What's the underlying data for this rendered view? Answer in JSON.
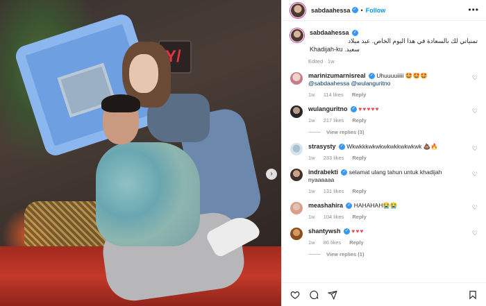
{
  "post": {
    "username": "sabdaahessa",
    "follow_label": "Follow",
    "more_label": "•••",
    "caption_line1": "تمنياتي لك بالسعادة في هذا اليوم الخاص. عيد ميلاد",
    "caption_line2": "سعيد. Khadijah-ku",
    "caption_edited": "Edited · 1w"
  },
  "comments": [
    {
      "user": "marinizumarnisreal",
      "text": "Uhuuuuiiiii 🤩🤩🤩 ",
      "mention": "@sabdaahessa @wulanguritno",
      "time": "1w",
      "likes": "114 likes",
      "reply": "Reply",
      "view_replies": ""
    },
    {
      "user": "wulanguritno",
      "text": "",
      "hearts": "♥♥♥♥♥",
      "time": "1w",
      "likes": "217 likes",
      "reply": "Reply",
      "view_replies": "View replies (3)"
    },
    {
      "user": "strasysty",
      "text": "Wkwkkkwkwkwkwkkwkwkwk 💩🔥",
      "time": "1w",
      "likes": "233 likes",
      "reply": "Reply"
    },
    {
      "user": "indrabekti",
      "text": "selamat ulang tahun untuk khadijah nyaaaaaa",
      "time": "1w",
      "likes": "131 likes",
      "reply": "Reply"
    },
    {
      "user": "meashahira",
      "text": "HAHAHAH😭😭",
      "time": "1w",
      "likes": "104 likes",
      "reply": "Reply"
    },
    {
      "user": "shantywsh",
      "text": "",
      "hearts": "♥♥♥",
      "time": "1w",
      "likes": "86 likes",
      "reply": "Reply",
      "view_replies": "View replies (1)"
    }
  ],
  "photo": {
    "sign_text": "Y/"
  },
  "icons": [
    "heart-icon",
    "comment-icon",
    "share-icon",
    "save-icon",
    "chevron-right-icon",
    "verified-icon",
    "more-icon"
  ],
  "colors": {
    "accent": "#0095f6",
    "verified": "#3897f0",
    "heart": "#ed4956"
  }
}
